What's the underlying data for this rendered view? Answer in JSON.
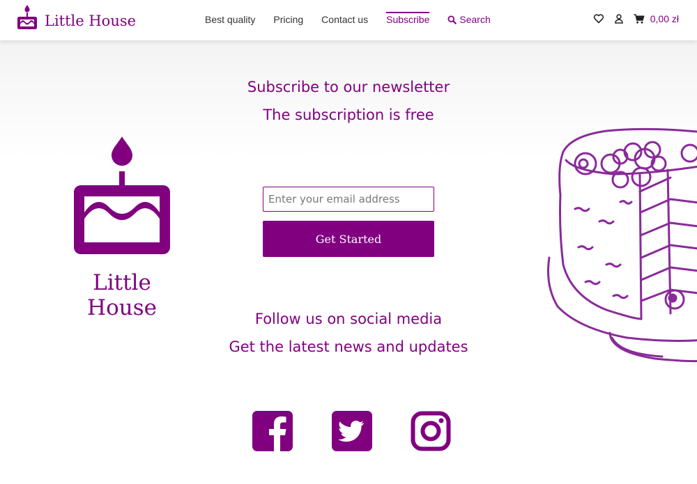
{
  "header": {
    "brand_name": "Little House",
    "nav": [
      {
        "label": "Best quality"
      },
      {
        "label": "Pricing"
      },
      {
        "label": "Contact us"
      },
      {
        "label": "Subscribe"
      }
    ],
    "search_label": "Search",
    "cart_amount": "0,00 zł",
    "icons": [
      "heart-icon",
      "user-icon",
      "cart-icon"
    ]
  },
  "hero": {
    "line1": "Subscribe to our newsletter",
    "line2": "The subscription is free"
  },
  "logo_name": "Little House",
  "form": {
    "email_placeholder": "Enter your email address",
    "email_value": "",
    "button_label": "Get Started"
  },
  "social_section": {
    "line1": "Follow us on social media",
    "line2": "Get the latest news and updates",
    "icons": [
      "facebook-icon",
      "twitter-icon",
      "instagram-icon"
    ]
  },
  "colors": {
    "brand": "#800080",
    "text": "#333333",
    "background": "#ffffff"
  }
}
